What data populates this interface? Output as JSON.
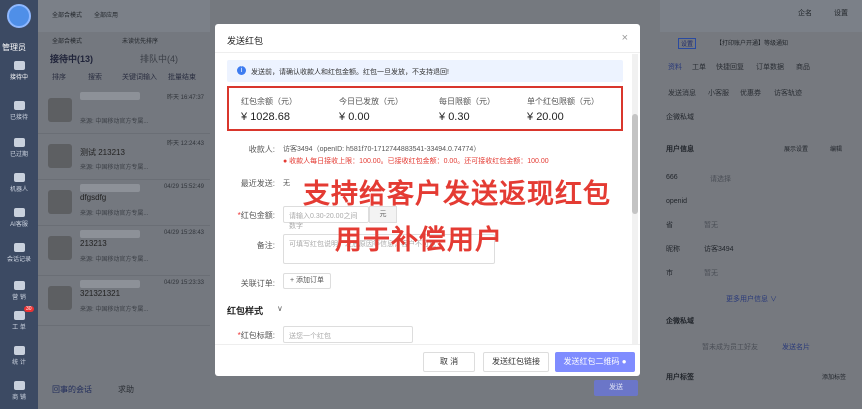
{
  "sidebar": {
    "title": "管理员",
    "items": [
      {
        "label": "接待中"
      },
      {
        "label": "已接待"
      },
      {
        "label": "已过期"
      },
      {
        "label": "机器人"
      },
      {
        "label": "AI客服"
      },
      {
        "label": "会话记录"
      },
      {
        "label": "营 销"
      },
      {
        "label": "工 单"
      },
      {
        "label": "统 计"
      },
      {
        "label": "商 铺"
      }
    ],
    "badge": "30"
  },
  "topbar": {
    "mode_label": "全部合模式",
    "app_label": "全部应用",
    "mode2_label": "全部合模式",
    "status_label": "未读优先排序",
    "account_label": "企名",
    "settings_label": "设置"
  },
  "list": {
    "tab_active": "接待中(13)",
    "tab_other": "排队中(4)",
    "tools": [
      "排序",
      "搜索",
      "关键词输入",
      "批量结束"
    ],
    "items": [
      {
        "name": "",
        "time": "昨天 16:47:37",
        "sub": "来源: 中国移动官方专属...",
        "tag": "@正在火热预测"
      },
      {
        "name": "测试 213213",
        "time": "昨天 12:24:43",
        "sub": "来源: 中国移动官方专属...",
        "tag": "@正在火热预测"
      },
      {
        "name": "dfgsdfg",
        "time": "04/29 15:52:49",
        "sub": "来源: 中国移动官方专属...",
        "tag": "@正在火热预测"
      },
      {
        "name": "213213",
        "time": "04/29 15:28:43",
        "sub": "来源: 中国移动官方专属...",
        "tag": "@正在火热预测"
      },
      {
        "name": "321321321",
        "time": "04/29 15:23:33",
        "sub": "来源: 中国移动官方专属...",
        "tag": "@正在火热预测"
      }
    ],
    "footer": "回事的会话",
    "footer_status": "求助"
  },
  "modal": {
    "title": "发送红包",
    "close": "×",
    "notice": "发送前，请确认收款人和红包金额。红包一旦发放，不支持退回!",
    "stats": [
      {
        "label": "红包余额（元）",
        "prefix": "¥ ",
        "value": "1028.68"
      },
      {
        "label": "今日已发放（元）",
        "prefix": "¥ ",
        "value": "0.00"
      },
      {
        "label": "每日限额（元）",
        "prefix": "¥ ",
        "value": "0.30"
      },
      {
        "label": "单个红包限额（元）",
        "prefix": "¥ ",
        "value": "20.00"
      }
    ],
    "receiver_label": "收款人:",
    "receiver_value": "访客3494（openID: h581f70-1712744883541-33494.0.74774）",
    "receiver_limit": "● 收款人每日接收上限：100.00。已接收红包金额：0.00。还可接收红包金额：100.00",
    "recent_label": "最近发送:",
    "recent_value": "无",
    "amount_label": "红包金额:",
    "amount_placeholder": "请输入0.30-20.00之间数字",
    "amount_unit": "元",
    "note_label": "备注:",
    "note_placeholder": "可填写红包说明、发放原因等信息，客户不可见",
    "order_label": "关联订单:",
    "order_button": "+ 添加订单",
    "style_section": "红包样式",
    "style_chevron": "∨",
    "title_label": "红包标题:",
    "title_placeholder": "送您一个红包",
    "overlay1": "支持给客户发送返现红包",
    "overlay2": "用于补偿用户",
    "btn_cancel": "取 消",
    "btn_link": "发送红包链接",
    "btn_qr": "发送红包二维码 ●"
  },
  "right": {
    "top_tabs": [
      "设置",
      "【打印账户开通】等级通知"
    ],
    "tabs": [
      "资料",
      "工单",
      "快捷回复",
      "订单数据",
      "商品"
    ],
    "tabs2": [
      "发送消息",
      "小客服",
      "优惠券",
      "访客轨迹"
    ],
    "crm": "企微私域",
    "user_info": "用户信息",
    "btn_show": "展示设置",
    "btn_edit": "编辑",
    "fields": [
      {
        "k": "666",
        "v": "请选择"
      },
      {
        "k": "openid",
        "v": ""
      },
      {
        "k": "省",
        "v": "暂无"
      },
      {
        "k": "昵称",
        "v": "访客3494"
      },
      {
        "k": "市",
        "v": "暂无"
      }
    ],
    "more": "更多用户信息 ∨",
    "wecom": "企微私域",
    "wecom_tip": "暂未成为员工好友",
    "send_card": "发送名片",
    "user_tag": "用户标签",
    "add_tag": "添加标签",
    "send": "发送"
  },
  "colors": {
    "accent": "#3e7cf0",
    "danger": "#e43b33",
    "primary_btn": "#7f8cff"
  }
}
